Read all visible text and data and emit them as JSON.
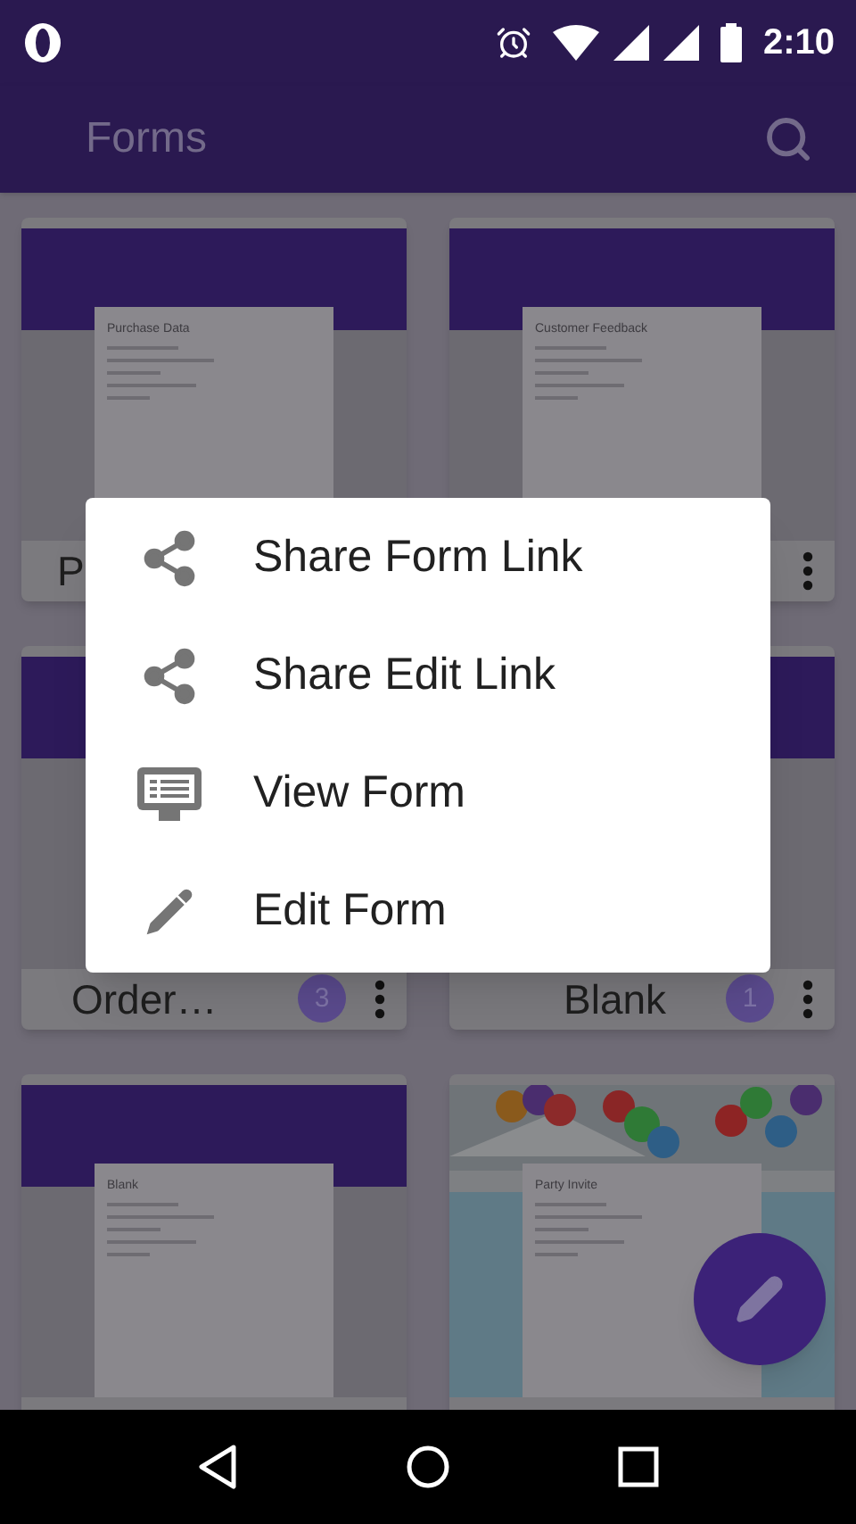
{
  "status_bar": {
    "time": "2:10"
  },
  "app_bar": {
    "title": "Forms"
  },
  "forms": [
    {
      "kind": "plain",
      "preview_title": "Purchase Data",
      "label": "P"
    },
    {
      "kind": "plain",
      "preview_title": "Customer Feedback",
      "menu_visible": true
    },
    {
      "kind": "hidden",
      "label": "Order…",
      "count": "3",
      "menu_visible": true
    },
    {
      "kind": "hidden",
      "label": "Blank",
      "count": "1",
      "menu_visible": true
    },
    {
      "kind": "plain",
      "preview_title": "Blank"
    },
    {
      "preview_title": "Party Invite"
    }
  ],
  "menu": [
    {
      "kind": "share",
      "label": "Share Form Link"
    },
    {
      "kind": "share",
      "label": "Share Edit Link"
    },
    {
      "kind": "view",
      "label": "View Form"
    },
    {
      "kind": "edit",
      "label": "Edit Form"
    }
  ]
}
